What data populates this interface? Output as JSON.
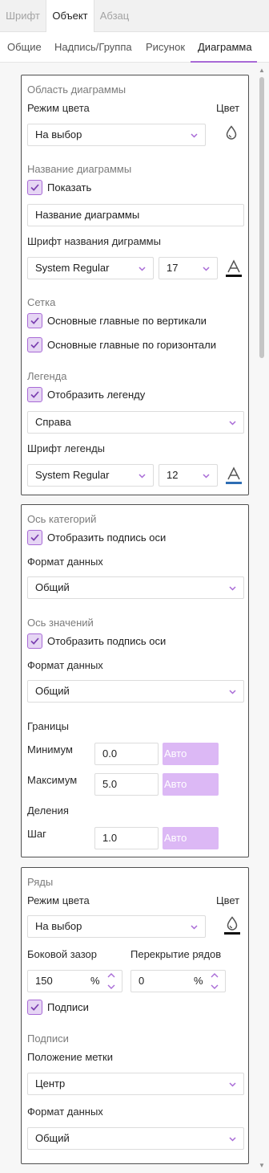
{
  "top_tabs": [
    {
      "label": "Шрифт",
      "active": false
    },
    {
      "label": "Объект",
      "active": true
    },
    {
      "label": "Абзац",
      "active": false
    }
  ],
  "sub_tabs": [
    {
      "label": "Общие",
      "active": false
    },
    {
      "label": "Надпись/Группа",
      "active": false
    },
    {
      "label": "Рисунок",
      "active": false
    },
    {
      "label": "Диаграмма",
      "active": true
    }
  ],
  "colors": {
    "accent": "#a86ad6",
    "check_fill": "#e6d6f4",
    "auto_button": "#dcb8f5",
    "panel_border": "#4f4f4f"
  },
  "chart_area": {
    "title": "Область диаграммы",
    "color_mode_label": "Режим цвета",
    "color_label": "Цвет",
    "color_mode_value": "На выбор",
    "color_icon": "drop-icon",
    "chart_title_section": "Название диаграммы",
    "show_label": "Показать",
    "show_checked": true,
    "title_input_value": "Название диаграммы",
    "title_font_label": "Шрифт названия диграммы",
    "title_font_family": "System Regular",
    "title_font_size": "17",
    "grid_section": "Сетка",
    "grid_vertical_label": "Основные главные по вертикали",
    "grid_vertical_checked": true,
    "grid_horizontal_label": "Основные главные по горизонтали",
    "grid_horizontal_checked": true,
    "legend_section": "Легенда",
    "show_legend_label": "Отобразить легенду",
    "show_legend_checked": true,
    "legend_position": "Справа",
    "legend_font_label": "Шрифт легенды",
    "legend_font_family": "System Regular",
    "legend_font_size": "12"
  },
  "axes": {
    "category_section": "Ось категорий",
    "category_show_label": "Отобразить подпись оси",
    "category_show_checked": true,
    "category_format_label": "Формат данных",
    "category_format_value": "Общий",
    "value_section": "Ось значений",
    "value_show_label": "Отобразить подпись оси",
    "value_show_checked": true,
    "value_format_label": "Формат данных",
    "value_format_value": "Общий",
    "bounds_label": "Границы",
    "min_label": "Минимум",
    "min_value": "0.0",
    "max_label": "Максимум",
    "max_value": "5.0",
    "divisions_label": "Деления",
    "step_label": "Шаг",
    "step_value": "1.0",
    "auto_label": "Авто"
  },
  "series": {
    "section": "Ряды",
    "color_mode_label": "Режим цвета",
    "color_label": "Цвет",
    "color_mode_value": "На выбор",
    "gap_label": "Боковой зазор",
    "gap_value": "150",
    "overlap_label": "Перекрытие рядов",
    "overlap_value": "0",
    "percent_sign": "%",
    "labels_label": "Подписи",
    "labels_checked": true,
    "labels_section": "Подписи",
    "label_position_label": "Положение метки",
    "label_position_value": "Центр",
    "format_label": "Формат данных",
    "format_value": "Общий"
  }
}
